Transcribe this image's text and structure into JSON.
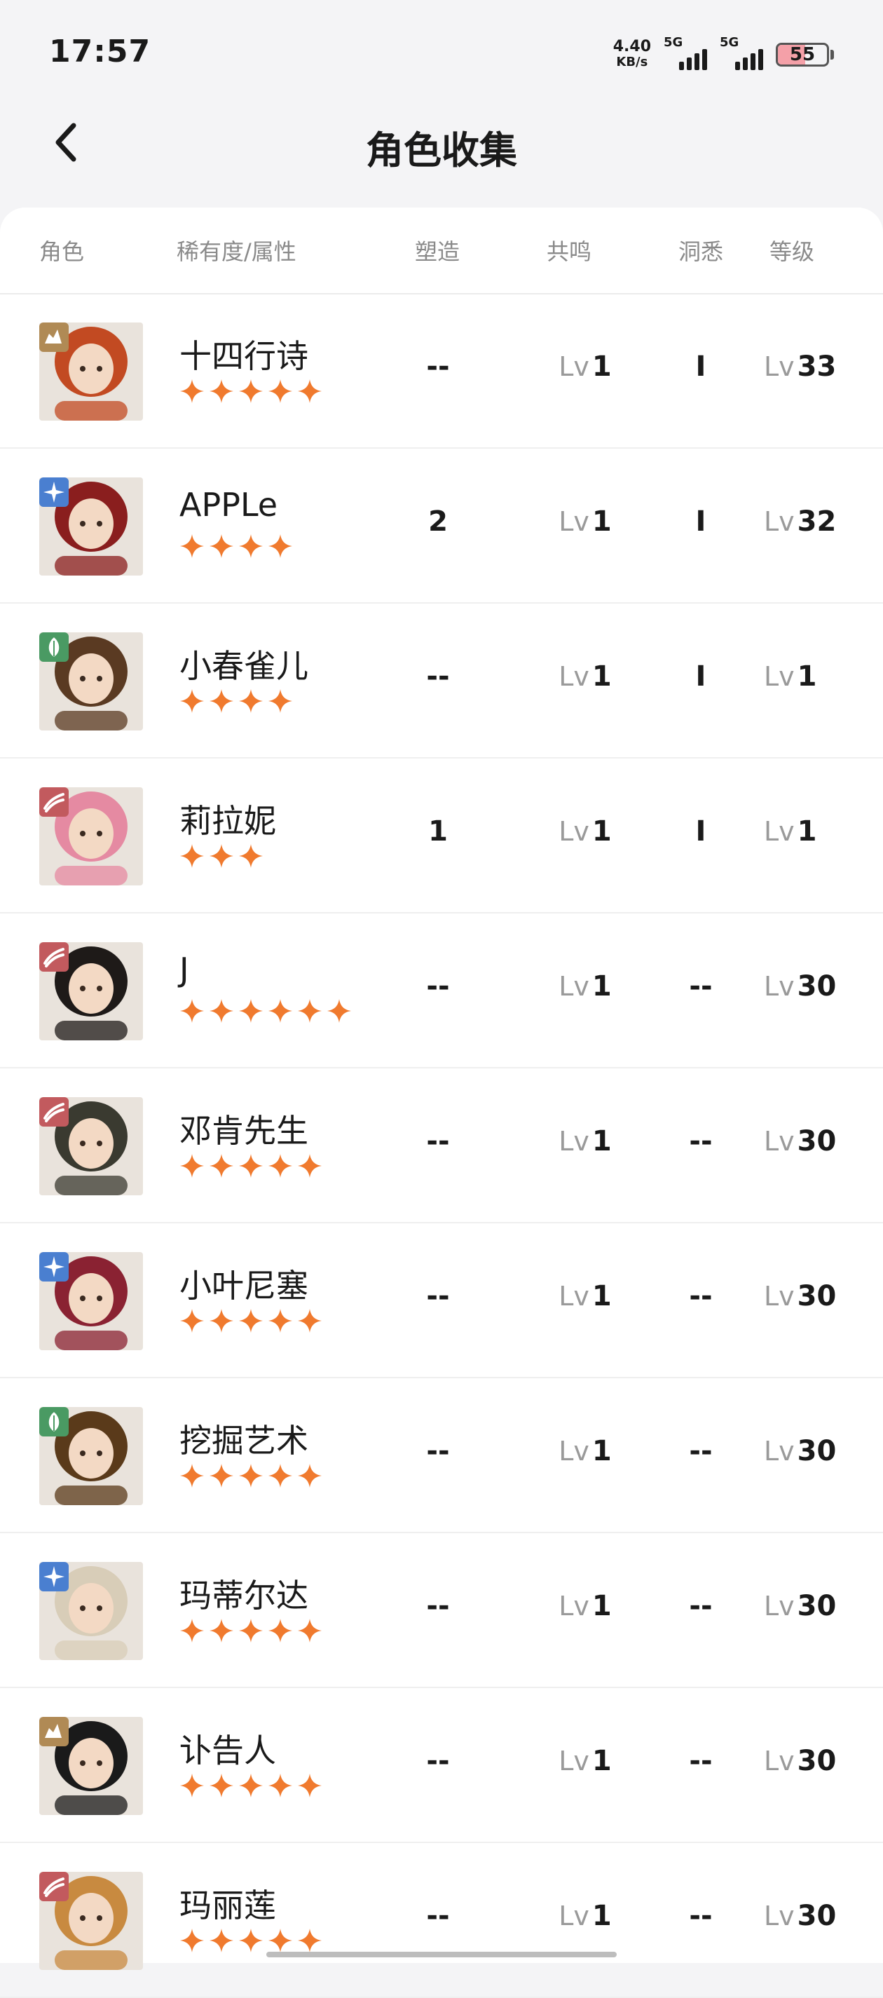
{
  "status_bar": {
    "time": "17:57",
    "net_speed_value": "4.40",
    "net_speed_unit": "KB/s",
    "sim1_label": "5G",
    "sim2_label": "5G",
    "battery_level": "55",
    "battery_fill_percent": 55
  },
  "nav": {
    "title": "角色收集",
    "back_icon": "chevron-left-icon"
  },
  "table": {
    "headers": {
      "character": "角色",
      "rarity_attribute": "稀有度/属性",
      "shaping": "塑造",
      "resonance": "共鸣",
      "insight": "洞悉",
      "level": "等级"
    },
    "lv_prefix": "Lv"
  },
  "element_colors": {
    "beast": "#b08a55",
    "star": "#4a7fd0",
    "plant": "#4a9a63",
    "mineral": "#c25a5e"
  },
  "star_color": "#f07a2e",
  "rows": [
    {
      "name": "十四行诗",
      "stars": 5,
      "element": "beast",
      "element_icon": "beast-element-icon",
      "shaping": "--",
      "resonance": "1",
      "insight": "I",
      "level": "33",
      "hair": "#c24a22"
    },
    {
      "name": "APPLe",
      "stars": 4,
      "element": "star",
      "element_icon": "star-element-icon",
      "shaping": "2",
      "resonance": "1",
      "insight": "I",
      "level": "32",
      "hair": "#8a1e1e"
    },
    {
      "name": "小春雀儿",
      "stars": 4,
      "element": "plant",
      "element_icon": "plant-element-icon",
      "shaping": "--",
      "resonance": "1",
      "insight": "I",
      "level": "1",
      "hair": "#5a3a22"
    },
    {
      "name": "莉拉妮",
      "stars": 3,
      "element": "mineral",
      "element_icon": "mineral-element-icon",
      "shaping": "1",
      "resonance": "1",
      "insight": "I",
      "level": "1",
      "hair": "#e58aa2"
    },
    {
      "name": "J",
      "stars": 6,
      "element": "mineral",
      "element_icon": "mineral-element-icon",
      "shaping": "--",
      "resonance": "1",
      "insight": "--",
      "level": "30",
      "hair": "#1e1a18"
    },
    {
      "name": "邓肯先生",
      "stars": 5,
      "element": "mineral",
      "element_icon": "mineral-element-icon",
      "shaping": "--",
      "resonance": "1",
      "insight": "--",
      "level": "30",
      "hair": "#3a3a30"
    },
    {
      "name": "小叶尼塞",
      "stars": 5,
      "element": "star",
      "element_icon": "star-element-icon",
      "shaping": "--",
      "resonance": "1",
      "insight": "--",
      "level": "30",
      "hair": "#8a2232"
    },
    {
      "name": "挖掘艺术",
      "stars": 5,
      "element": "plant",
      "element_icon": "plant-element-icon",
      "shaping": "--",
      "resonance": "1",
      "insight": "--",
      "level": "30",
      "hair": "#5a3a1a"
    },
    {
      "name": "玛蒂尔达",
      "stars": 5,
      "element": "star",
      "element_icon": "star-element-icon",
      "shaping": "--",
      "resonance": "1",
      "insight": "--",
      "level": "30",
      "hair": "#d8cdb8"
    },
    {
      "name": "讣告人",
      "stars": 5,
      "element": "beast",
      "element_icon": "beast-element-icon",
      "shaping": "--",
      "resonance": "1",
      "insight": "--",
      "level": "30",
      "hair": "#1a1a1a"
    },
    {
      "name": "玛丽莲",
      "stars": 5,
      "element": "mineral",
      "element_icon": "mineral-element-icon",
      "shaping": "--",
      "resonance": "1",
      "insight": "--",
      "level": "30",
      "hair": "#c88a40"
    }
  ]
}
